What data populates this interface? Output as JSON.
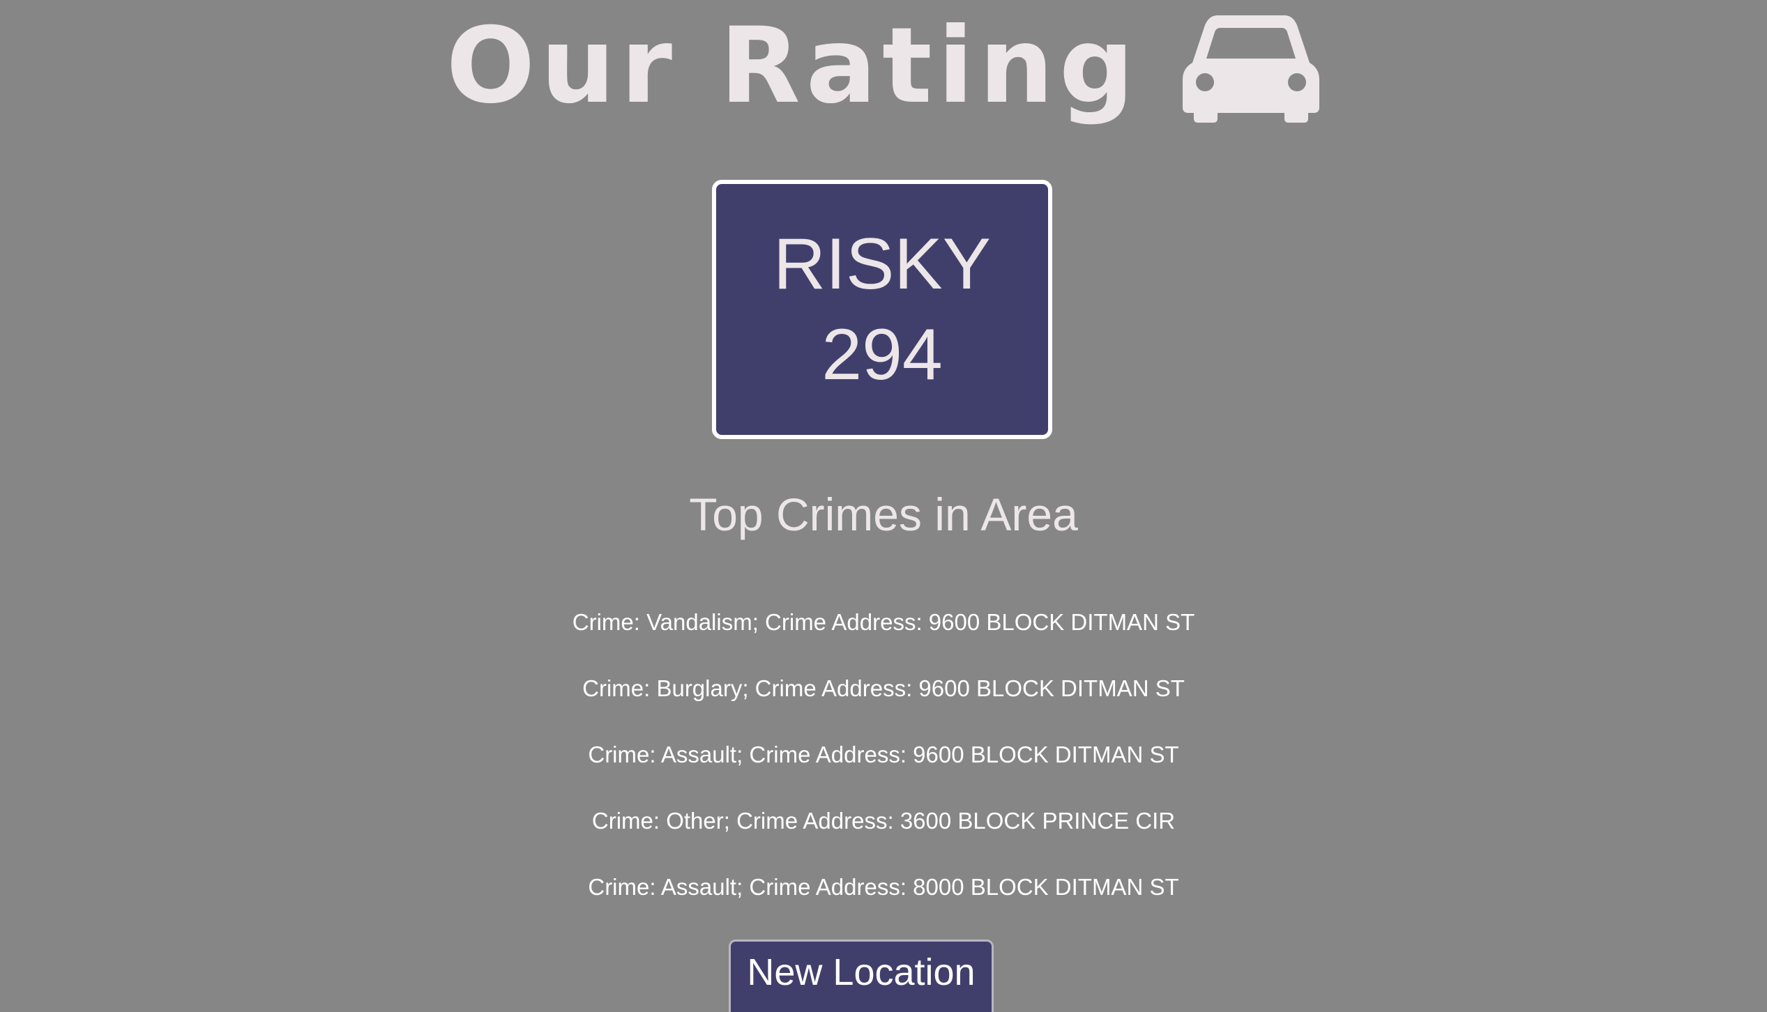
{
  "header": {
    "title": "Our Rating",
    "icon": "car-icon"
  },
  "rating": {
    "label": "RISKY",
    "score": "294"
  },
  "crimes_section": {
    "title": "Top Crimes in Area",
    "items": [
      "Crime: Vandalism; Crime Address: 9600 BLOCK DITMAN ST",
      "Crime: Burglary; Crime Address: 9600 BLOCK DITMAN ST",
      "Crime: Assault; Crime Address: 9600 BLOCK DITMAN ST",
      "Crime: Other; Crime Address: 3600 BLOCK PRINCE CIR",
      "Crime: Assault; Crime Address: 8000 BLOCK DITMAN ST"
    ]
  },
  "actions": {
    "new_location_label": "New Location"
  },
  "colors": {
    "background": "#868686",
    "accent": "#403f6c",
    "text_light": "#ece6e8"
  }
}
